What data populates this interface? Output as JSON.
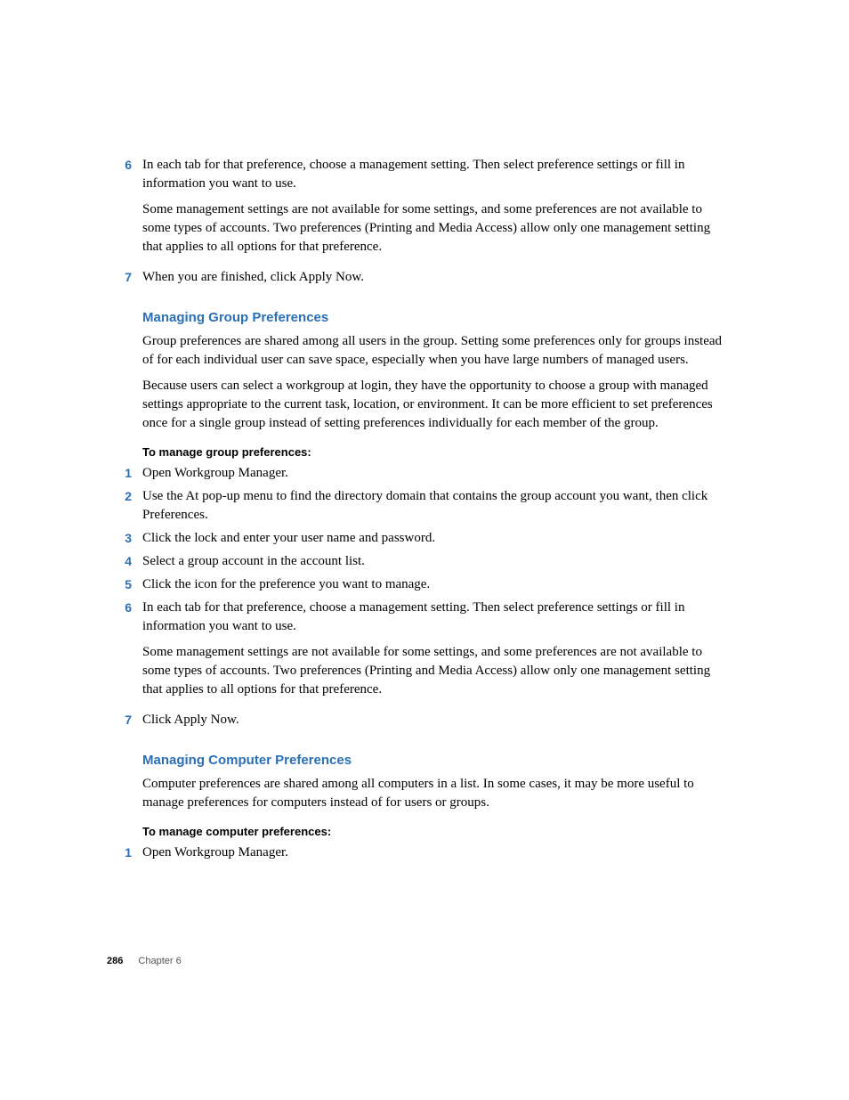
{
  "top_steps": [
    {
      "n": "6",
      "paras": [
        "In each tab for that preference, choose a management setting. Then select preference settings or fill in information you want to use.",
        "Some management settings are not available for some settings, and some preferences are not available to some types of accounts. Two preferences (Printing and Media Access) allow only one management setting that applies to all options for that preference."
      ]
    },
    {
      "n": "7",
      "paras": [
        "When you are finished, click Apply Now."
      ]
    }
  ],
  "section_group": {
    "heading": "Managing Group Preferences",
    "paras": [
      "Group preferences are shared among all users in the group. Setting some preferences only for groups instead of for each individual user can save space, especially when you have large numbers of managed users.",
      "Because users can select a workgroup at login, they have the opportunity to choose a group with managed settings appropriate to the current task, location, or environment. It can be more efficient to set preferences once for a single group instead of setting preferences individually for each member of the group."
    ],
    "subhead": "To manage group preferences:",
    "steps": [
      {
        "n": "1",
        "paras": [
          "Open Workgroup Manager."
        ]
      },
      {
        "n": "2",
        "paras": [
          "Use the At pop-up menu to find the directory domain that contains the group account you want, then click Preferences."
        ]
      },
      {
        "n": "3",
        "paras": [
          "Click the lock and enter your user name and password."
        ]
      },
      {
        "n": "4",
        "paras": [
          "Select a group account in the account list."
        ]
      },
      {
        "n": "5",
        "paras": [
          "Click the icon for the preference you want to manage."
        ]
      },
      {
        "n": "6",
        "paras": [
          "In each tab for that preference, choose a management setting. Then select preference settings or fill in information you want to use.",
          "Some management settings are not available for some settings, and some preferences are not available to some types of accounts. Two preferences (Printing and Media Access) allow only one management setting that applies to all options for that preference."
        ]
      },
      {
        "n": "7",
        "paras": [
          "Click Apply Now."
        ]
      }
    ]
  },
  "section_computer": {
    "heading": "Managing Computer Preferences",
    "paras": [
      "Computer preferences are shared among all computers in a list. In some cases, it may be more useful to manage preferences for computers instead of for users or groups."
    ],
    "subhead": "To manage computer preferences:",
    "steps": [
      {
        "n": "1",
        "paras": [
          "Open Workgroup Manager."
        ]
      }
    ]
  },
  "footer": {
    "page": "286",
    "chapter": "Chapter 6"
  }
}
